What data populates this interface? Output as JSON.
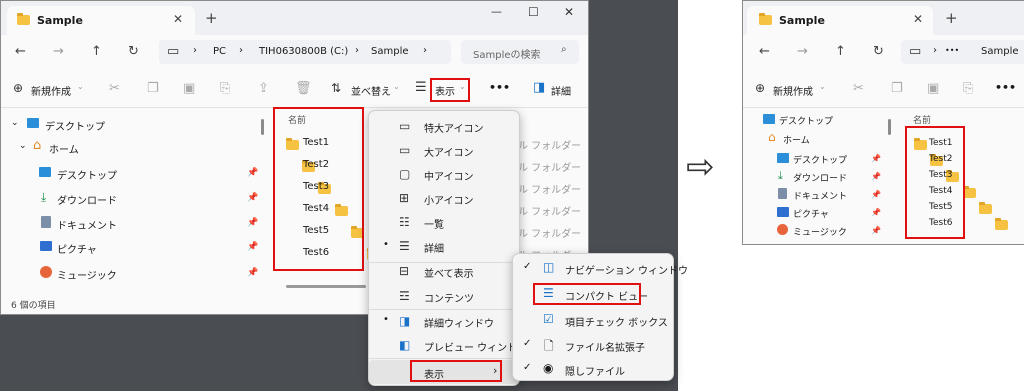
{
  "left_window": {
    "tab_title": "Sample",
    "new_tab": "+",
    "window_controls": [
      "—",
      "☐",
      "✕"
    ],
    "breadcrumb": [
      "PC",
      "TIH0630800B (C:)",
      "Sample"
    ],
    "search_placeholder": "Sampleの検索",
    "toolbar": {
      "new_label": "新規作成",
      "sort_label": "並べ替え",
      "view_label": "表示",
      "more_label": "•••",
      "details_label": "詳細"
    },
    "sidebar": [
      {
        "label": "デスクトップ",
        "icon": "desktop-icon",
        "level": 0
      },
      {
        "label": "ホーム",
        "icon": "home-icon",
        "level": 0
      },
      {
        "label": "デスクトップ",
        "icon": "desktop-icon",
        "level": 1
      },
      {
        "label": "ダウンロード",
        "icon": "download-icon",
        "level": 1
      },
      {
        "label": "ドキュメント",
        "icon": "document-icon",
        "level": 1
      },
      {
        "label": "ピクチャ",
        "icon": "pictures-icon",
        "level": 1
      },
      {
        "label": "ミュージック",
        "icon": "music-icon",
        "level": 1
      }
    ],
    "column_name": "名前",
    "column_type_partial": "類",
    "files": [
      "Test1",
      "Test2",
      "Test3",
      "Test4",
      "Test5",
      "Test6"
    ],
    "type_values": [
      "イル フォルダー",
      "イル フォルダー",
      "イル フォルダー",
      "イル フォルダー",
      "イル フォルダー",
      "イル フォルダー"
    ],
    "status": "6 個の項目"
  },
  "view_menu": {
    "items": [
      {
        "label": "特大アイコン",
        "icon": "extra-large-icons-icon",
        "checked": false
      },
      {
        "label": "大アイコン",
        "icon": "large-icons-icon",
        "checked": false
      },
      {
        "label": "中アイコン",
        "icon": "medium-icons-icon",
        "checked": false
      },
      {
        "label": "小アイコン",
        "icon": "small-icons-icon",
        "checked": false
      },
      {
        "label": "一覧",
        "icon": "list-icon",
        "checked": false
      },
      {
        "label": "詳細",
        "icon": "details-icon",
        "checked": true
      },
      {
        "label": "並べて表示",
        "icon": "tiles-icon",
        "checked": false
      },
      {
        "label": "コンテンツ",
        "icon": "content-icon",
        "checked": false
      },
      {
        "label": "詳細ウィンドウ",
        "icon": "details-pane-icon",
        "checked": true
      },
      {
        "label": "プレビュー ウィンドウ",
        "icon": "preview-pane-icon",
        "checked": false
      },
      {
        "label": "表示",
        "icon": "",
        "checked": false,
        "submenu": true
      }
    ]
  },
  "show_submenu": {
    "items": [
      {
        "label": "ナビゲーション ウィンドウ",
        "checked": true
      },
      {
        "label": "コンパクト ビュー",
        "checked": false
      },
      {
        "label": "項目チェック ボックス",
        "checked": false
      },
      {
        "label": "ファイル名拡張子",
        "checked": true
      },
      {
        "label": "隠しファイル",
        "checked": true
      }
    ]
  },
  "arrow": "⇨",
  "right_window": {
    "tab_title": "Sample",
    "new_tab": "+",
    "breadcrumb_more": "•••",
    "breadcrumb_current": "Sample",
    "new_label": "新規作成",
    "more_label": "•••",
    "sidebar": [
      {
        "label": "デスクトップ",
        "level": 0
      },
      {
        "label": "ホーム",
        "level": 0
      },
      {
        "label": "デスクトップ",
        "level": 1
      },
      {
        "label": "ダウンロード",
        "level": 1
      },
      {
        "label": "ドキュメント",
        "level": 1
      },
      {
        "label": "ピクチャ",
        "level": 1
      },
      {
        "label": "ミュージック",
        "level": 1
      }
    ],
    "column_name": "名前",
    "files": [
      "Test1",
      "Test2",
      "Test3",
      "Test4",
      "Test5",
      "Test6"
    ]
  },
  "colors": {
    "highlight": "#e01010",
    "folder": "#f5c242",
    "accent": "#1a73c8"
  }
}
